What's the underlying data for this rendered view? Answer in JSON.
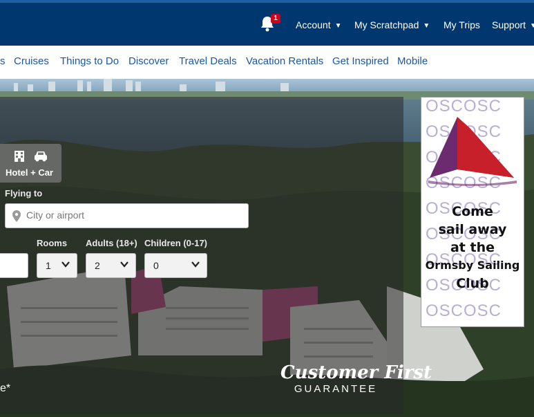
{
  "header": {
    "notification_count": "1",
    "nav": [
      {
        "label": "Account",
        "has_dropdown": true
      },
      {
        "label": "My Scratchpad",
        "has_dropdown": true
      },
      {
        "label": "My Trips",
        "has_dropdown": false
      },
      {
        "label": "Support",
        "has_dropdown": true
      }
    ]
  },
  "subnav": {
    "items": [
      "s",
      "Cruises",
      "Things to Do",
      "Discover",
      "Travel Deals",
      "Vacation Rentals",
      "Get Inspired",
      "Mobile"
    ]
  },
  "search": {
    "tab_label": "Hotel + Car",
    "flying_to_label": "Flying to",
    "flying_to_placeholder": "City or airport",
    "rooms_label": "Rooms",
    "rooms_value": "1",
    "adults_label": "Adults (18+)",
    "adults_value": "2",
    "children_label": "Children (0-17)",
    "children_value": "0"
  },
  "hero": {
    "guarantee_title": "Customer First",
    "guarantee_sub": "GUARANTEE",
    "partial_text": "e*"
  },
  "ad": {
    "pattern": "OSCOSC",
    "lines": [
      "Come",
      "sail away",
      "at the",
      "Ormsby Sailing",
      "Club"
    ]
  },
  "colors": {
    "header_bg": "#00376f",
    "link": "#1a57a6",
    "badge": "#d0021b",
    "sail_red": "#c8202a",
    "sail_purple": "#6b2b6e"
  }
}
